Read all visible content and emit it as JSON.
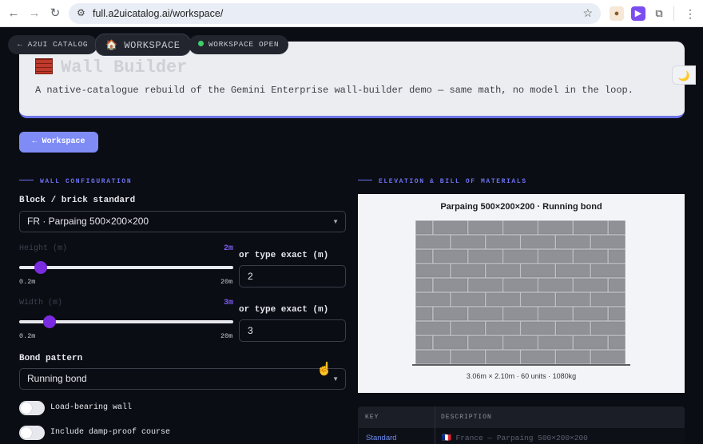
{
  "browser": {
    "url": "full.a2uicatalog.ai/workspace/",
    "icons": [
      "back-arrow",
      "forward-arrow",
      "reload",
      "site-settings",
      "star",
      "cookie-extension",
      "video-extension",
      "puzzle-extension",
      "menu-kebab"
    ]
  },
  "topbar": {
    "catalog_link": "← A2UI CATALOG",
    "workspace_tab": "🏠 WORKSPACE",
    "workspace_status": "WORKSPACE OPEN",
    "status_color": "#3ecf6a"
  },
  "hero": {
    "title": "Wall Builder",
    "subtitle": "A native-catalogue rebuild of the Gemini Enterprise wall-builder demo — same math, no model in the loop."
  },
  "back_button": "← Workspace",
  "config": {
    "section_label": "WALL CONFIGURATION",
    "block_label": "Block / brick standard",
    "block_value": "FR · Parpaing 500×200×200",
    "height": {
      "label": "Height (m)",
      "value": "2m",
      "min_label": "0.2m",
      "max_label": "20m",
      "exact_label": "or type exact (m)",
      "exact_value": "2",
      "fraction": 0.1
    },
    "width": {
      "label": "Width (m)",
      "value": "3m",
      "min_label": "0.2m",
      "max_label": "20m",
      "exact_label": "or type exact (m)",
      "exact_value": "3",
      "fraction": 0.14
    },
    "bond_label": "Bond pattern",
    "bond_value": "Running bond",
    "toggles": [
      {
        "label": "Load-bearing wall",
        "on": false
      },
      {
        "label": "Include damp-proof course",
        "on": false
      }
    ]
  },
  "elevation": {
    "section_label": "ELEVATION & BILL OF MATERIALS",
    "title": "Parpaing 500×200×200 · Running bond",
    "caption": "3.06m × 2.10m · 60 units · 1080kg",
    "courses": 10,
    "blocks_per_course": 6
  },
  "table": {
    "headers": [
      "KEY",
      "DESCRIPTION"
    ],
    "rows": [
      {
        "key": "Standard",
        "description": "🇫🇷 France — Parpaing 500×200×200"
      }
    ]
  },
  "accent": "#6b72f0"
}
